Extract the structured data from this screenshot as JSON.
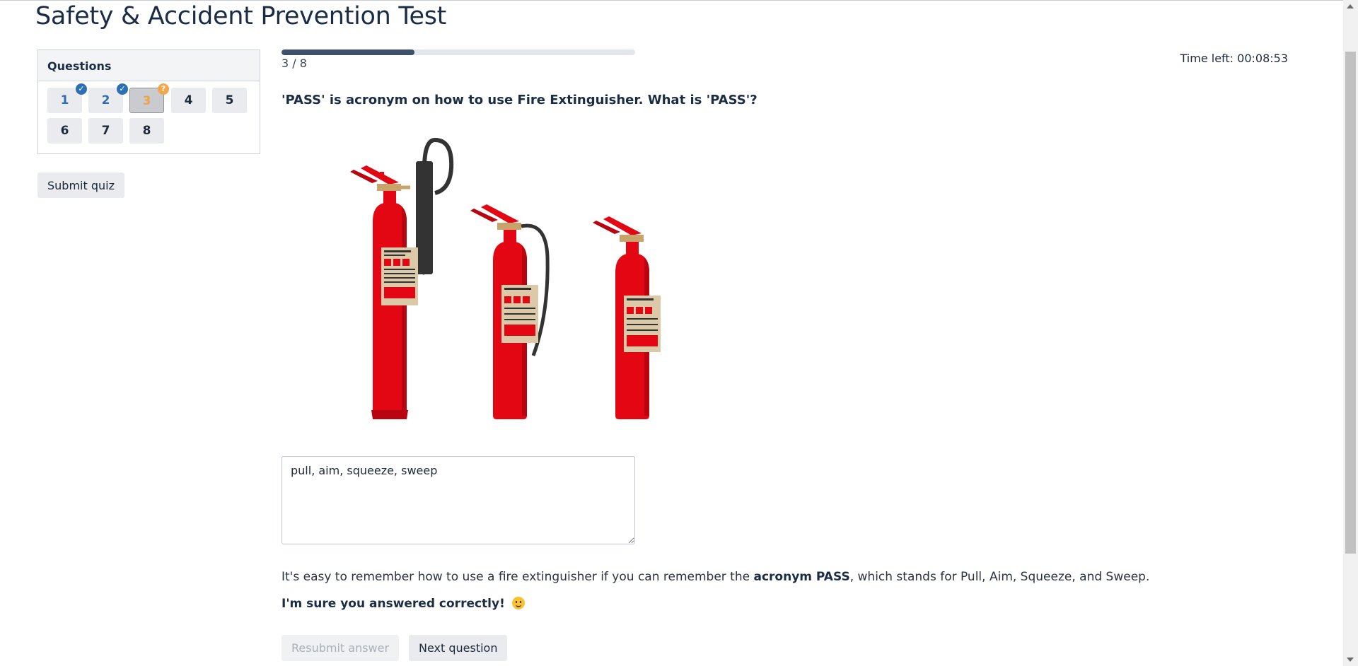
{
  "page": {
    "title": "Safety & Accident Prevention Test"
  },
  "sidebar": {
    "header": "Questions",
    "questions": [
      {
        "label": "1",
        "state": "answered"
      },
      {
        "label": "2",
        "state": "answered"
      },
      {
        "label": "3",
        "state": "current"
      },
      {
        "label": "4",
        "state": "unanswered"
      },
      {
        "label": "5",
        "state": "unanswered"
      },
      {
        "label": "6",
        "state": "unanswered"
      },
      {
        "label": "7",
        "state": "unanswered"
      },
      {
        "label": "8",
        "state": "unanswered"
      }
    ],
    "badges": {
      "answered": "✓",
      "current": "?"
    },
    "submit_label": "Submit quiz"
  },
  "progress": {
    "label": "3 / 8",
    "fraction": 0.375
  },
  "timer": {
    "text": "Time left: 00:08:53"
  },
  "question": {
    "text": "'PASS' is acronym on how to use Fire Extinguisher. What is 'PASS'?",
    "image_icon": "fire-extinguishers-illustration",
    "answer_value": "pull, aim, squeeze, sweep"
  },
  "explanation": {
    "before": "It's easy to remember how to use a fire extinguisher if you can remember the ",
    "bold": "acronym PASS",
    "after": ", which stands for Pull, Aim, Squeeze, and Sweep."
  },
  "feedback": {
    "text": "I'm sure you answered correctly! ",
    "icon": "smile-emoji-icon"
  },
  "actions": {
    "resubmit_label": "Resubmit answer",
    "next_label": "Next question"
  },
  "colors": {
    "accent": "#3e506a",
    "answered": "#2d6fb3",
    "current": "#f4a64a",
    "extinguisher": "#e30613"
  }
}
